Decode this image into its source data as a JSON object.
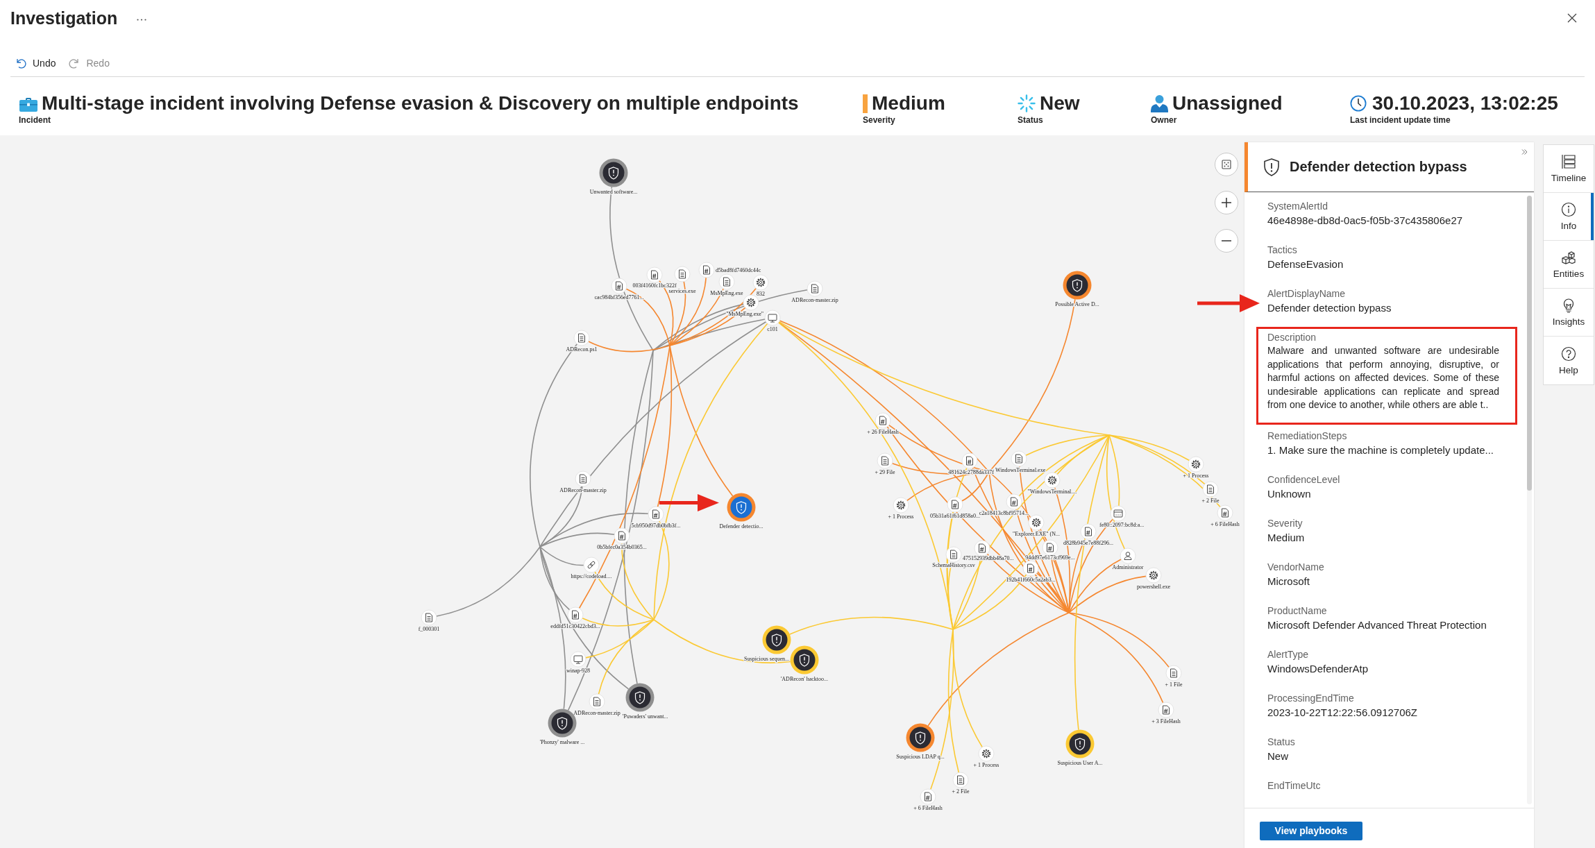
{
  "window": {
    "title": "Investigation"
  },
  "toolbar": [
    {
      "label": "Undo",
      "kind": "undo",
      "disabled": false
    },
    {
      "label": "Redo",
      "kind": "redo",
      "disabled": true
    }
  ],
  "incident": {
    "title": "Multi-stage incident involving Defense evasion & Discovery on multiple endpoints",
    "subtitle": "Incident"
  },
  "stats": [
    {
      "kind": "severity",
      "value": "Medium",
      "label": "Severity"
    },
    {
      "kind": "status",
      "value": "New",
      "label": "Status"
    },
    {
      "kind": "owner",
      "value": "Unassigned",
      "label": "Owner"
    },
    {
      "kind": "time",
      "value": "30.10.2023, 13:02:25",
      "label": "Last incident update time"
    }
  ],
  "graph": {
    "alerts": [
      {
        "label": "Unwanted software...",
        "color": "#8f8f8f",
        "selected": false
      },
      {
        "label": "Possible Active D...",
        "color": "#f5872f",
        "selected": false
      },
      {
        "label": "Defender detectio...",
        "color": "#f5872f",
        "selected": true
      },
      {
        "label": "Suspicious sequen...",
        "color": "#fbc933",
        "selected": false
      },
      {
        "label": "'ADRecon' hacktoo...",
        "color": "#fbc933",
        "selected": false
      },
      {
        "label": "'Puwaders' unwant...",
        "color": "#8f8f8f",
        "selected": false
      },
      {
        "label": "'Phonzy' malware ...",
        "color": "#8f8f8f",
        "selected": false
      },
      {
        "label": "Suspicious LDAP q...",
        "color": "#f5872f",
        "selected": false
      },
      {
        "label": "Suspicious User A...",
        "color": "#fbc933",
        "selected": false
      }
    ],
    "entities": [
      {
        "kind": "hash",
        "label": "cac984bf356ed7761...",
        "selected": false
      },
      {
        "kind": "hash",
        "label": "003f4160fc1bc322f",
        "selected": false
      },
      {
        "kind": "file",
        "label": "services.exe",
        "selected": false
      },
      {
        "kind": "hash",
        "label": "d5bad8fd7460dc44c",
        "selected": false
      },
      {
        "kind": "file",
        "label": "MsMpEng.exe",
        "selected": false
      },
      {
        "kind": "process",
        "label": "832",
        "selected": false
      },
      {
        "kind": "file",
        "label": "ADRecon-master.zip",
        "selected": false
      },
      {
        "kind": "process",
        "label": "\"MsMpEng.exe\"",
        "selected": false
      },
      {
        "kind": "device",
        "label": "c101",
        "selected": false
      },
      {
        "kind": "file",
        "label": "ADRecon.ps1",
        "selected": false
      },
      {
        "kind": "file",
        "label": "ADRecon-master.zip",
        "selected": false
      },
      {
        "kind": "hash",
        "label": "5cb950d97db0bfb3f...",
        "selected": false
      },
      {
        "kind": "hash",
        "label": "0b5bfec0a354b0365...",
        "selected": false
      },
      {
        "kind": "link",
        "label": "https://codeload....",
        "selected": false
      },
      {
        "kind": "hash",
        "label": "eddfd51c30422cbd3...",
        "selected": false
      },
      {
        "kind": "file",
        "label": "f_000301",
        "selected": false
      },
      {
        "kind": "device",
        "label": "winap-928",
        "selected": false
      },
      {
        "kind": "file",
        "label": "ADRecon-master.zip",
        "selected": false
      },
      {
        "kind": "hash",
        "label": "+ 26 FileHash",
        "selected": false
      },
      {
        "kind": "file",
        "label": "+ 29 File",
        "selected": false
      },
      {
        "kind": "hash",
        "label": "481624c2788da337f",
        "selected": false
      },
      {
        "kind": "file",
        "label": "WindowsTerminal.exe",
        "selected": false
      },
      {
        "kind": "process",
        "label": "\"WindowsTerminal....",
        "selected": false
      },
      {
        "kind": "process",
        "label": "+ 1 Process",
        "selected": false
      },
      {
        "kind": "hash",
        "label": "05b31a61f61d858a0...",
        "selected": false
      },
      {
        "kind": "hash",
        "label": "c2a18413c8bf95714...",
        "selected": false
      },
      {
        "kind": "process",
        "label": "\"Explorer.EXE\" (N...",
        "selected": false
      },
      {
        "kind": "ip",
        "label": "fe80::2097:bc8d:a...",
        "selected": false
      },
      {
        "kind": "hash",
        "label": "d828b945e7e88f296...",
        "selected": false
      },
      {
        "kind": "file",
        "label": "SchemaHistory.csv",
        "selected": false
      },
      {
        "kind": "hash",
        "label": "475152939dbb48a70...",
        "selected": false
      },
      {
        "kind": "hash",
        "label": "94dd97e6173cf969e...",
        "selected": false
      },
      {
        "kind": "hash",
        "label": "192b41f660c5a2ab3...",
        "selected": false
      },
      {
        "kind": "user",
        "label": "Administrator",
        "selected": false
      },
      {
        "kind": "process",
        "label": "powershell.exe",
        "selected": false
      },
      {
        "kind": "process",
        "label": "+ 1 Process",
        "selected": false
      },
      {
        "kind": "file",
        "label": "+ 2 File",
        "selected": false
      },
      {
        "kind": "hash",
        "label": "+ 6 FileHash",
        "selected": false
      },
      {
        "kind": "file",
        "label": "+ 1 File",
        "selected": false
      },
      {
        "kind": "hash",
        "label": "+ 3 FileHash",
        "selected": false
      },
      {
        "kind": "process",
        "label": "+ 1 Process",
        "selected": false
      },
      {
        "kind": "file",
        "label": "+ 2 File",
        "selected": false
      },
      {
        "kind": "hash",
        "label": "+ 6 FileHash",
        "selected": false
      }
    ]
  },
  "details": {
    "title": "Defender detection bypass",
    "fields": [
      {
        "label": "SystemAlertId",
        "value": "46e4898e-db8d-0ac5-f05b-37c435806e27",
        "highlighted": false
      },
      {
        "label": "Tactics",
        "value": "DefenseEvasion",
        "highlighted": false
      },
      {
        "label": "AlertDisplayName",
        "value": "Defender detection bypass",
        "highlighted": false
      },
      {
        "label": "Description",
        "value": "Malware and unwanted software are undesirable applications that perform annoying, disruptive, or harmful actions on affected devices. Some of these undesirable applications can replicate and spread from one device to another, while others are able t..",
        "highlighted": true
      },
      {
        "label": "RemediationSteps",
        "value": "1. Make sure the machine is completely update...",
        "highlighted": false
      },
      {
        "label": "ConfidenceLevel",
        "value": "Unknown",
        "highlighted": false
      },
      {
        "label": "Severity",
        "value": "Medium",
        "highlighted": false
      },
      {
        "label": "VendorName",
        "value": "Microsoft",
        "highlighted": false
      },
      {
        "label": "ProductName",
        "value": "Microsoft Defender Advanced Threat Protection",
        "highlighted": false
      },
      {
        "label": "AlertType",
        "value": "WindowsDefenderAtp",
        "highlighted": false
      },
      {
        "label": "ProcessingEndTime",
        "value": "2023-10-22T12:22:56.0912706Z",
        "highlighted": false
      },
      {
        "label": "Status",
        "value": "New",
        "highlighted": false
      },
      {
        "label": "EndTimeUtc",
        "highlighted": false
      }
    ],
    "button": "View playbooks"
  },
  "side_tabs": [
    {
      "kind": "timeline",
      "label": "Timeline",
      "selected": false
    },
    {
      "kind": "info",
      "label": "Info",
      "selected": true
    },
    {
      "kind": "entities",
      "label": "Entities",
      "selected": false
    },
    {
      "kind": "insights",
      "label": "Insights",
      "selected": false
    },
    {
      "kind": "help",
      "label": "Help",
      "selected": false
    }
  ]
}
